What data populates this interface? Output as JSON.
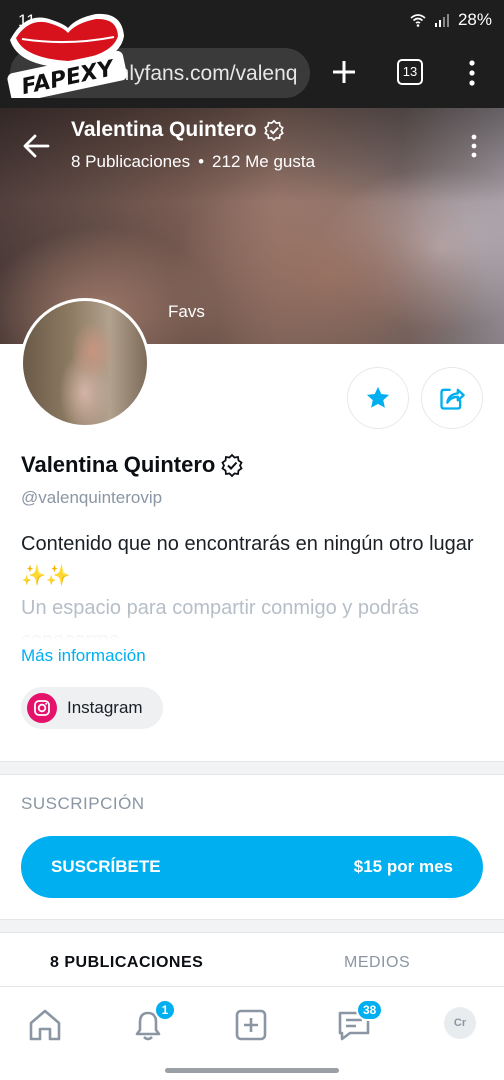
{
  "status_bar": {
    "time": "11",
    "battery": "28%"
  },
  "browser": {
    "url": "onlyfans.com/valenq",
    "tab_count": "13"
  },
  "watermark": {
    "text": "FAPEXY"
  },
  "cover": {
    "name": "Valentina Quintero",
    "posts": "8 Publicaciones",
    "likes": "212 Me gusta",
    "separator": "•",
    "label": "Favs"
  },
  "profile": {
    "name": "Valentina Quintero",
    "handle": "@valenquinterovip",
    "bio_line1": "Contenido que no encontrarás en ningún otro lugar ✨✨",
    "bio_line2": "Un espacio para compartir conmigo y podrás conocerme...",
    "more_info": "Más información",
    "social_label": "Instagram"
  },
  "subscription": {
    "heading": "SUSCRIPCIÓN",
    "button_label": "SUSCRÍBETE",
    "price": "$15 por mes"
  },
  "tabs": {
    "posts": "8 PUBLICACIONES",
    "media": "MEDIOS"
  },
  "bottom_nav": {
    "notifications_badge": "1",
    "messages_badge": "38",
    "avatar_initials": "Cr"
  },
  "colors": {
    "accent": "#00aff0",
    "instagram": "#e4126b"
  }
}
